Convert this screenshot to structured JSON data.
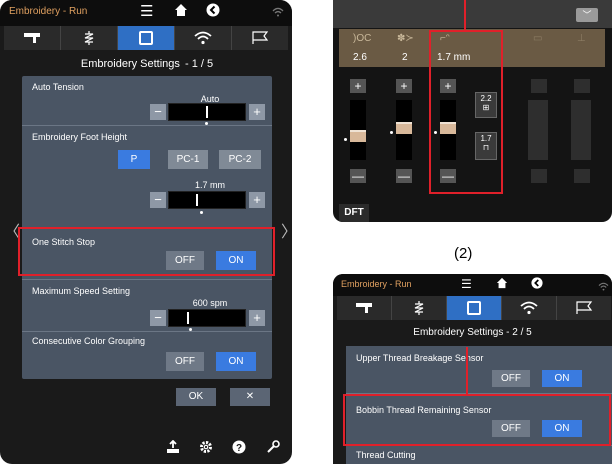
{
  "left": {
    "mode": "Embroidery - Run",
    "title": "Embroidery Settings",
    "page": "-  1 / 5",
    "settings": {
      "auto_tension": {
        "label": "Auto Tension",
        "value": "Auto"
      },
      "foot_height": {
        "label": "Embroidery Foot Height",
        "options": [
          "P",
          "PC-1",
          "PC-2"
        ],
        "selected": "P",
        "value": "1.7 mm"
      },
      "one_stitch_stop": {
        "label": "One Stitch Stop",
        "off": "OFF",
        "on": "ON",
        "selected": "ON"
      },
      "max_speed": {
        "label": "Maximum Speed Setting",
        "value": "600  spm"
      },
      "color_grouping": {
        "label": "Consecutive Color Grouping",
        "off": "OFF",
        "on": "ON",
        "selected": "ON"
      }
    },
    "ok": "OK",
    "cancel": "✕",
    "plus": "+",
    "minus": "−"
  },
  "right_top": {
    "values": [
      "2.6",
      "2",
      "1.7 mm"
    ],
    "pct_1": "2.2",
    "pct_2": "1.7",
    "plus": "+",
    "minus": "—",
    "dft": "DFT",
    "dropdown": "﹀"
  },
  "label_2": "(2)",
  "right_bottom": {
    "mode": "Embroidery - Run",
    "title": "Embroidery Settings",
    "page": "-  2 / 5",
    "upper_sensor": {
      "label": "Upper Thread Breakage Sensor",
      "off": "OFF",
      "on": "ON"
    },
    "bobbin_sensor": {
      "label": "Bobbin Thread Remaining Sensor",
      "off": "OFF",
      "on": "ON"
    },
    "thread_cutting": {
      "label": "Thread Cutting"
    }
  },
  "colors": {
    "highlight": "#e0202a",
    "accent": "#3a7be0",
    "panel": "#4a5564"
  }
}
